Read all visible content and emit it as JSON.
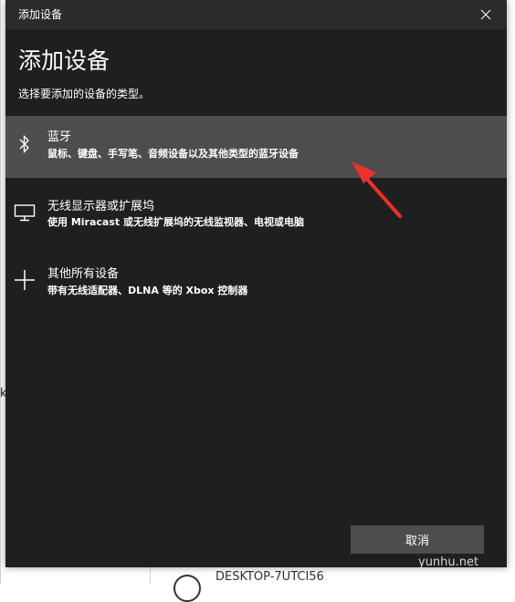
{
  "background": {
    "edge_char": "k",
    "computer_name": "DESKTOP-7UTCI56"
  },
  "dialog": {
    "window_title": "添加设备",
    "heading": "添加设备",
    "subtitle": "选择要添加的设备的类型。",
    "options": [
      {
        "icon": "bluetooth-icon",
        "title": "蓝牙",
        "description": "鼠标、键盘、手写笔、音频设备以及其他类型的蓝牙设备",
        "selected": true
      },
      {
        "icon": "monitor-icon",
        "title": "无线显示器或扩展坞",
        "description": "使用 Miracast 或无线扩展坞的无线监视器、电视或电脑",
        "selected": false
      },
      {
        "icon": "plus-icon",
        "title": "其他所有设备",
        "description": "带有无线适配器、DLNA 等的 Xbox 控制器",
        "selected": false
      }
    ],
    "cancel_label": "取消"
  },
  "watermark": "yunhu.net",
  "colors": {
    "dialog_bg": "#1f1f1f",
    "titlebar_bg": "#2b2b2b",
    "selected_row_bg": "#4d4d4d",
    "button_bg": "#4d4d4d",
    "annotation_arrow": "#e8322b"
  }
}
